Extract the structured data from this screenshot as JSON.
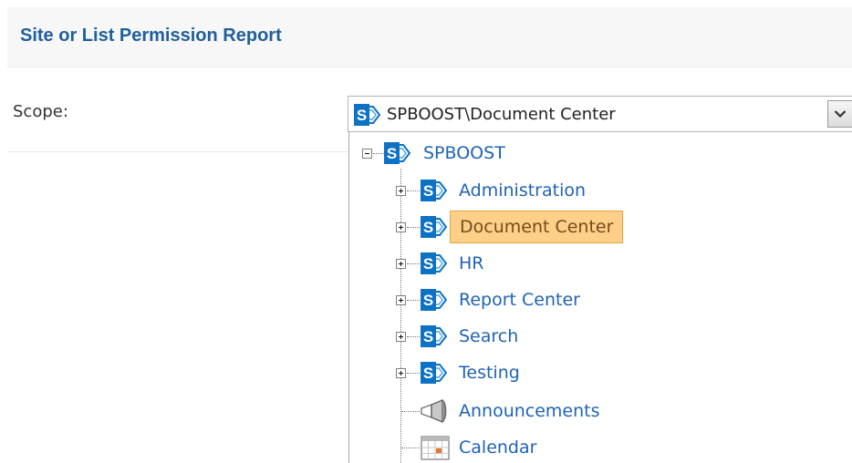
{
  "header": {
    "title": "Site or List Permission Report"
  },
  "scope": {
    "label": "Scope:",
    "selected_value": "SPBOOST\\Document Center"
  },
  "tree": {
    "root": {
      "label": "SPBOOST",
      "icon": "sharepoint-site-icon",
      "expanded": true
    },
    "children": [
      {
        "label": "Administration",
        "icon": "sharepoint-site-icon"
      },
      {
        "label": "Document Center",
        "icon": "sharepoint-site-icon"
      },
      {
        "label": "HR",
        "icon": "sharepoint-site-icon"
      },
      {
        "label": "Report Center",
        "icon": "sharepoint-site-icon"
      },
      {
        "label": "Search",
        "icon": "sharepoint-site-icon"
      },
      {
        "label": "Testing",
        "icon": "sharepoint-site-icon"
      },
      {
        "label": "Announcements",
        "icon": "announcements-list-icon"
      },
      {
        "label": "Calendar",
        "icon": "calendar-list-icon"
      }
    ]
  },
  "colors": {
    "title": "#1f5f9e",
    "link": "#1f63b4",
    "selection_bg": "#fcd088",
    "selection_border": "#e9a43b",
    "sp_blue": "#0e72c4"
  }
}
